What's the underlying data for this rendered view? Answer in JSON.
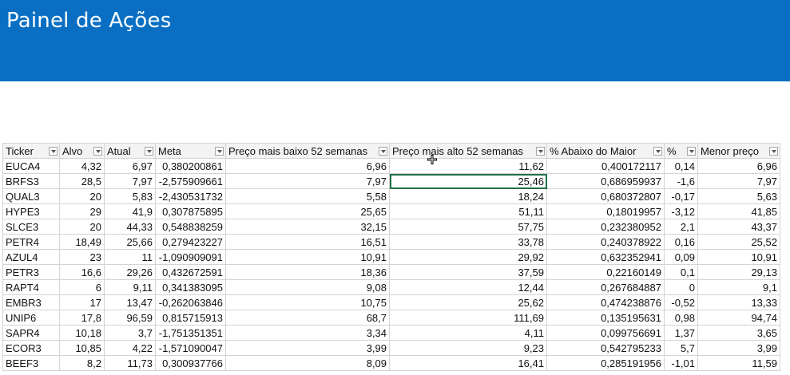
{
  "title": "Painel de Ações",
  "columns": [
    "Ticker",
    "Alvo",
    "Atual",
    "Meta",
    "Preço mais baixo 52 semanas",
    "Preço mais alto 52 semanas",
    "% Abaixo do Maior",
    "%",
    "Menor preço"
  ],
  "rows": [
    [
      "EUCA4",
      "4,32",
      "6,97",
      "0,380200861",
      "6,96",
      "11,62",
      "0,400172117",
      "0,14",
      "6,96"
    ],
    [
      "BRFS3",
      "28,5",
      "7,97",
      "-2,575909661",
      "7,97",
      "25,46",
      "0,686959937",
      "-1,6",
      "7,97"
    ],
    [
      "QUAL3",
      "20",
      "5,83",
      "-2,430531732",
      "5,58",
      "18,24",
      "0,680372807",
      "-0,17",
      "5,63"
    ],
    [
      "HYPE3",
      "29",
      "41,9",
      "0,307875895",
      "25,65",
      "51,11",
      "0,18019957",
      "-3,12",
      "41,85"
    ],
    [
      "SLCE3",
      "20",
      "44,33",
      "0,548838259",
      "32,15",
      "57,75",
      "0,232380952",
      "2,1",
      "43,37"
    ],
    [
      "PETR4",
      "18,49",
      "25,66",
      "0,279423227",
      "16,51",
      "33,78",
      "0,240378922",
      "0,16",
      "25,52"
    ],
    [
      "AZUL4",
      "23",
      "11",
      "-1,090909091",
      "10,91",
      "29,92",
      "0,632352941",
      "0,09",
      "10,91"
    ],
    [
      "PETR3",
      "16,6",
      "29,26",
      "0,432672591",
      "18,36",
      "37,59",
      "0,22160149",
      "0,1",
      "29,13"
    ],
    [
      "RAPT4",
      "6",
      "9,11",
      "0,341383095",
      "9,08",
      "12,44",
      "0,267684887",
      "0",
      "9,1"
    ],
    [
      "EMBR3",
      "17",
      "13,47",
      "-0,262063846",
      "10,75",
      "25,62",
      "0,474238876",
      "-0,52",
      "13,33"
    ],
    [
      "UNIP6",
      "17,8",
      "96,59",
      "0,815715913",
      "68,7",
      "111,69",
      "0,135195631",
      "0,98",
      "94,74"
    ],
    [
      "SAPR4",
      "10,18",
      "3,7",
      "-1,751351351",
      "3,34",
      "4,11",
      "0,099756691",
      "1,37",
      "3,65"
    ],
    [
      "ECOR3",
      "10,85",
      "4,22",
      "-1,571090047",
      "3,99",
      "9,23",
      "0,542795233",
      "5,7",
      "3,99"
    ],
    [
      "BEEF3",
      "8,2",
      "11,73",
      "0,300937766",
      "8,09",
      "16,41",
      "0,285191956",
      "-1,01",
      "11,59"
    ]
  ],
  "colors": {
    "banner": "#0a6fc2",
    "selection": "#1e7145"
  }
}
